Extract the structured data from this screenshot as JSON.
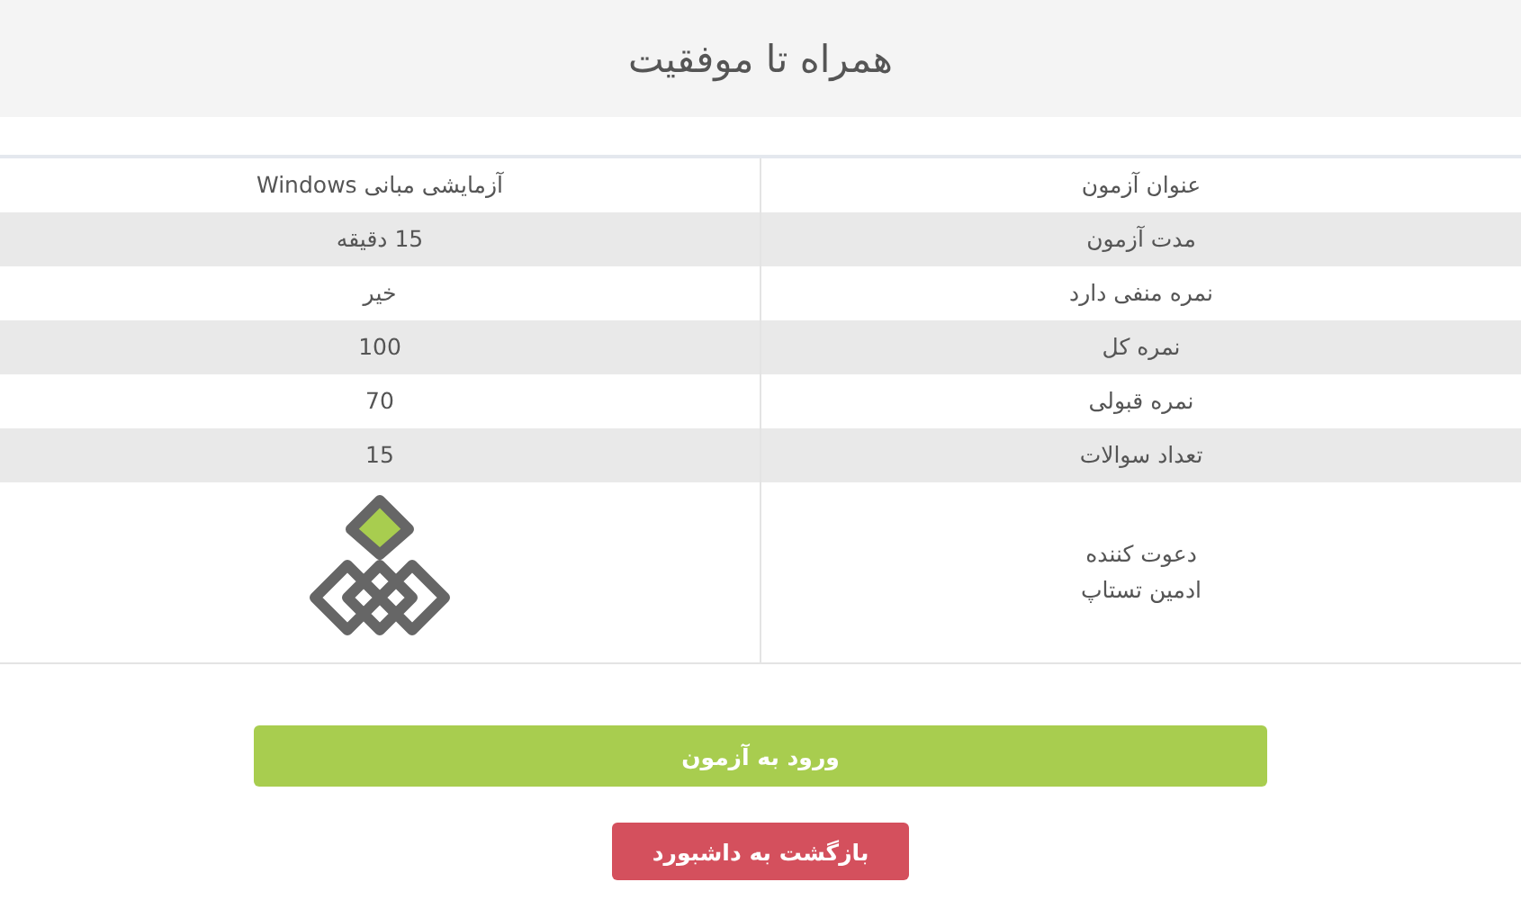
{
  "header": {
    "title": "همراه تا موفقیت"
  },
  "details": [
    {
      "kind": "text",
      "label": [
        "عنوان آزمون"
      ],
      "value": "آزمایشی مبانی Windows"
    },
    {
      "kind": "text",
      "label": [
        "مدت آزمون"
      ],
      "value": "15 دقیقه"
    },
    {
      "kind": "text",
      "label": [
        "نمره منفی دارد"
      ],
      "value": "خیر"
    },
    {
      "kind": "text",
      "label": [
        "نمره کل"
      ],
      "value": "100"
    },
    {
      "kind": "text",
      "label": [
        "نمره قبولی"
      ],
      "value": "70"
    },
    {
      "kind": "text",
      "label": [
        "تعداد سوالات"
      ],
      "value": "15"
    },
    {
      "kind": "logo",
      "label": [
        "دعوت کننده",
        "ادمین تستاپ"
      ]
    }
  ],
  "buttons": [
    {
      "label": "ورود به آزمون",
      "kind": "primary"
    },
    {
      "label": "بازگشت به داشبورد",
      "kind": "danger"
    }
  ]
}
